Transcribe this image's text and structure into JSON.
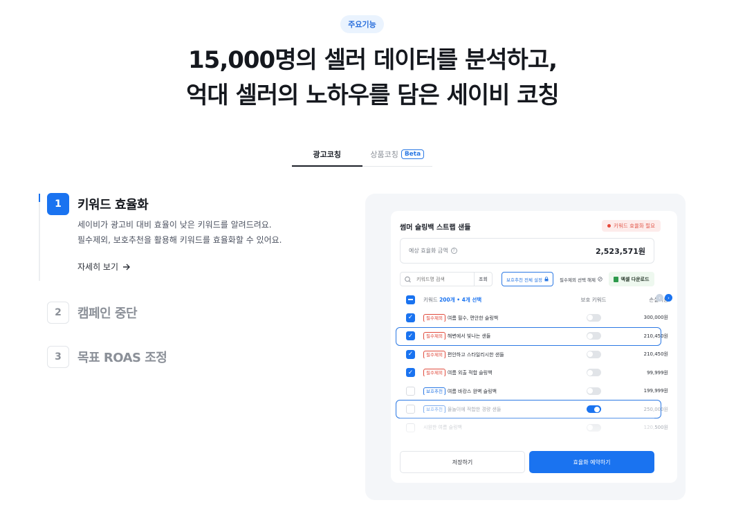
{
  "badge": "주요기능",
  "headline": {
    "line1": "15,000명의 셀러 데이터를 분석하고,",
    "line2": "억대 셀러의 노하우를 담은 세이비 코칭"
  },
  "tabs": [
    {
      "label": "광고코칭"
    },
    {
      "label": "상품코칭",
      "badge": "Beta"
    }
  ],
  "steps": [
    {
      "num": "1",
      "title": "키워드 효율화",
      "desc1": "세이비가 광고비 대비 효율이 낮은 키워드를 알려드려요.",
      "desc2": "필수제외, 보호추천을 활용해 키워드를 효율화할 수 있어요.",
      "more": "자세히 보기"
    },
    {
      "num": "2",
      "title": "캠페인 중단"
    },
    {
      "num": "3",
      "title": "목표 ROAS 조정"
    }
  ],
  "card": {
    "title": "썸머 슬링백 스트랩 샌들",
    "warning": "키워드 효율화 필요",
    "cost_label": "예상 효율화 금액",
    "cost_value": "2,523,571원",
    "search_placeholder": "키워드명 검색",
    "search_button": "조회",
    "protect_button": "보호추천 전체 설정",
    "must_button": "필수제외 선택 해제",
    "excel_button": "엑셀 다운로드",
    "header": {
      "keyword_prefix": "키워드",
      "count": "200개 • 4개 선택",
      "toggle": "보호 키워드",
      "amount": "손실비용"
    },
    "rows": [
      {
        "tag": "필수제외",
        "tag_type": "must",
        "keyword": "여름 필수, 편안한 슬링백",
        "amount": "300,000원",
        "checked": true,
        "toggle": false
      },
      {
        "tag": "필수제외",
        "tag_type": "must",
        "keyword": "해변에서 빛나는 샌들",
        "amount": "210,450원",
        "checked": true,
        "toggle": false
      },
      {
        "tag": "필수제외",
        "tag_type": "must",
        "keyword": "편안하고 스타일리시한 샌들",
        "amount": "210,450원",
        "checked": true,
        "toggle": false
      },
      {
        "tag": "필수제외",
        "tag_type": "must",
        "keyword": "여름 외출 적합 슬링백",
        "amount": "99,999원",
        "checked": true,
        "toggle": false
      },
      {
        "tag": "보호추천",
        "tag_type": "rec",
        "keyword": "여름 바캉스 완벽 슬링백",
        "amount": "199,999원",
        "checked": false,
        "toggle": false
      },
      {
        "tag": "보호추천",
        "tag_type": "rec",
        "keyword": "물놀이에 적합한 경량 샌들",
        "amount": "250,000원",
        "checked": false,
        "toggle": true
      },
      {
        "tag": "",
        "tag_type": "",
        "keyword": "시원한 여름 슬링백",
        "amount": "120,500원",
        "checked": false,
        "toggle": false
      }
    ],
    "save_button": "저장하기",
    "reserve_button": "효율화 예약하기"
  },
  "colors": {
    "accent": "#1a73f0",
    "danger": "#e04a3c",
    "excel": "#2e9a4c"
  }
}
